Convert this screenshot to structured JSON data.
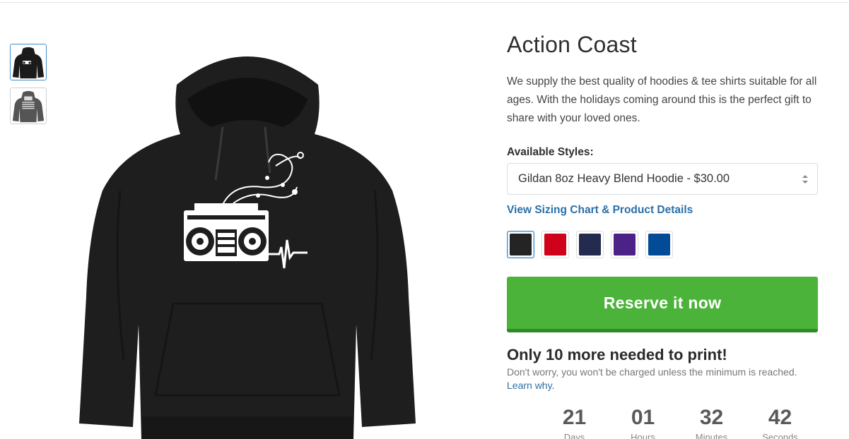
{
  "product": {
    "title": "Action Coast",
    "description": "We supply the best quality of hoodies & tee shirts suitable for all ages. With the holidays coming around this is the perfect gift to share with your loved ones."
  },
  "thumbnails": [
    {
      "name": "front view",
      "active": true,
      "color": "#1b1b1b"
    },
    {
      "name": "back view",
      "active": false,
      "color": "#4a4a4a"
    }
  ],
  "styles": {
    "label": "Available Styles:",
    "selected": "Gildan 8oz Heavy Blend Hoodie - $30.00"
  },
  "sizing_link": "View Sizing Chart & Product Details",
  "colors": [
    {
      "name": "black",
      "hex": "#242424",
      "selected": true
    },
    {
      "name": "red",
      "hex": "#d0021b",
      "selected": false
    },
    {
      "name": "navy",
      "hex": "#232b4f",
      "selected": false
    },
    {
      "name": "purple",
      "hex": "#4d2288",
      "selected": false
    },
    {
      "name": "royal blue",
      "hex": "#034b96",
      "selected": false
    }
  ],
  "reserve_button": "Reserve it now",
  "goal": {
    "headline": "Only 10 more needed to print!",
    "note": "Don't worry, you won't be charged unless the minimum is reached.",
    "learn_link": "Learn why."
  },
  "countdown": [
    {
      "value": "21",
      "label": "Days"
    },
    {
      "value": "01",
      "label": "Hours"
    },
    {
      "value": "32",
      "label": "Minutes"
    },
    {
      "value": "42",
      "label": "Seconds"
    }
  ],
  "theme": {
    "accent_green": "#4cb33a",
    "link_blue": "#2b70a8"
  }
}
